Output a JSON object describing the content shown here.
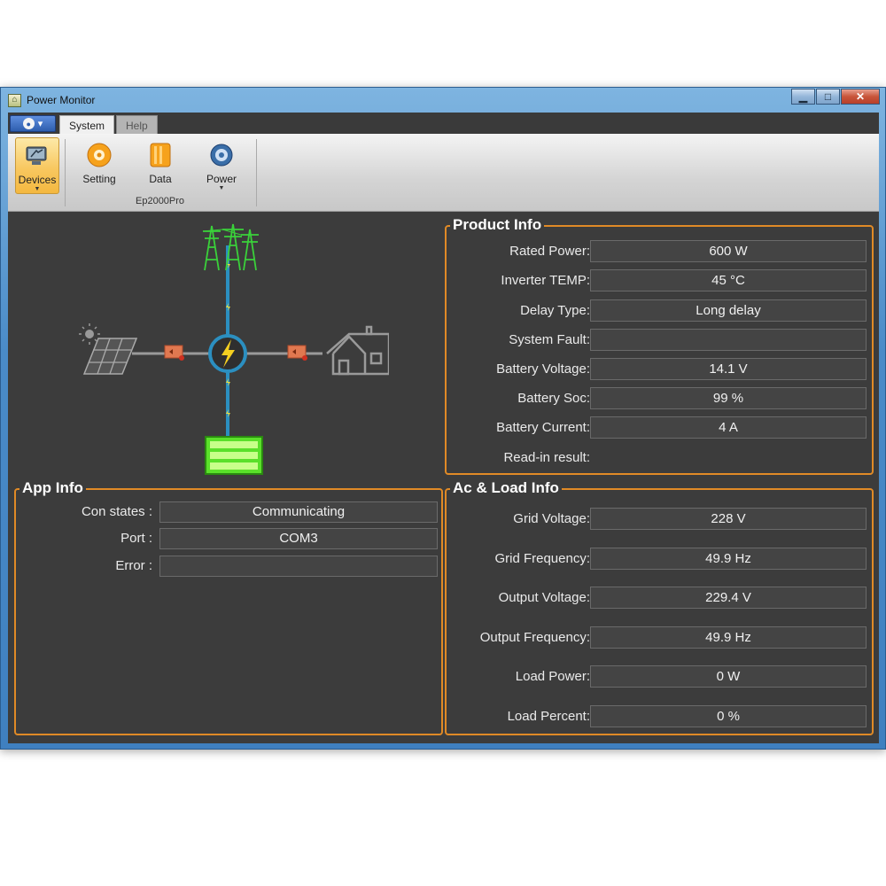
{
  "window": {
    "title": "Power Monitor",
    "minimize": "▁",
    "maximize": "□",
    "close": "✕"
  },
  "tabs": {
    "app_menu": "▾",
    "system": "System",
    "help": "Help"
  },
  "ribbon": {
    "devices": "Devices",
    "setting": "Setting",
    "data": "Data",
    "power": "Power",
    "group_label": "Ep2000Pro"
  },
  "product_info": {
    "title": "Product Info",
    "rows": [
      {
        "label": "Rated Power:",
        "value": "600 W"
      },
      {
        "label": "Inverter TEMP:",
        "value": "45 °C"
      },
      {
        "label": "Delay Type:",
        "value": "Long delay"
      },
      {
        "label": "System Fault:",
        "value": ""
      },
      {
        "label": "Battery Voltage:",
        "value": "14.1 V"
      },
      {
        "label": "Battery Soc:",
        "value": "99 %"
      },
      {
        "label": "Battery Current:",
        "value": "4 A"
      },
      {
        "label": "Read-in result:"
      }
    ]
  },
  "app_info": {
    "title": "App Info",
    "rows": [
      {
        "label": "Con states :",
        "value": "Communicating"
      },
      {
        "label": "Port :",
        "value": "COM3"
      },
      {
        "label": "Error :",
        "value": ""
      }
    ]
  },
  "ac_load_info": {
    "title": "Ac & Load Info",
    "rows": [
      {
        "label": "Grid Voltage:",
        "value": "228 V"
      },
      {
        "label": "Grid Frequency:",
        "value": "49.9 Hz"
      },
      {
        "label": "Output Voltage:",
        "value": "229.4 V"
      },
      {
        "label": "Output Frequency:",
        "value": "49.9 Hz"
      },
      {
        "label": "Load Power:",
        "value": "0 W"
      },
      {
        "label": "Load Percent:",
        "value": "0 %"
      }
    ]
  },
  "colors": {
    "panel_border": "#e08a26",
    "client_bg": "#3c3c3c",
    "grid_tower": "#3ad13a",
    "battery": "#5ae02a",
    "flow_line": "#2b8fc0"
  },
  "icons": {
    "grid": "power-tower-icon",
    "solar": "solar-panel-icon",
    "house": "house-icon",
    "battery": "battery-icon",
    "inverter": "inverter-lightning-icon"
  }
}
